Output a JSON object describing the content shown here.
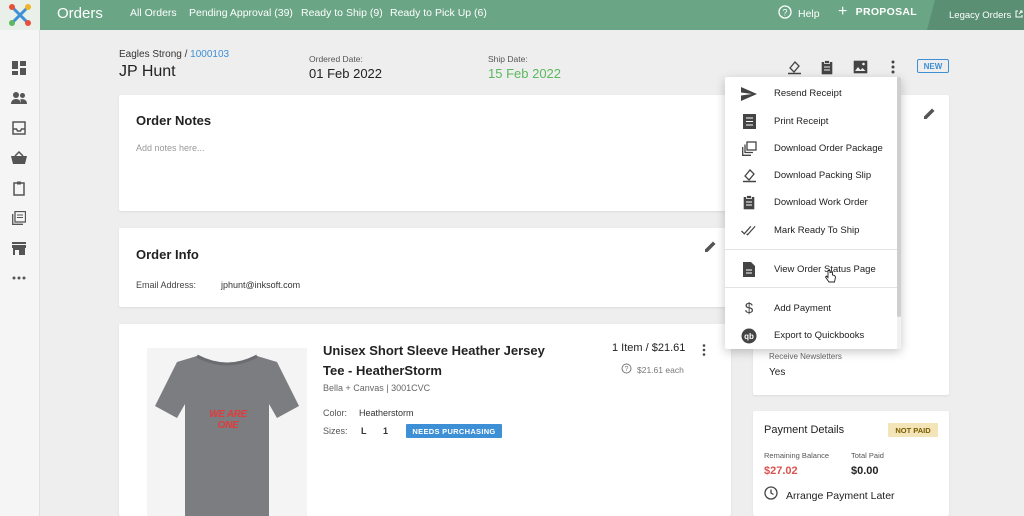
{
  "topbar": {
    "title": "Orders",
    "nav": [
      "All Orders",
      "Pending Approval (39)",
      "Ready to Ship (9)",
      "Ready to Pick Up (6)"
    ],
    "help": "Help",
    "proposal": "PROPOSAL",
    "legacy": "Legacy Orders"
  },
  "header": {
    "store": "Eagles Strong",
    "order_number": "1000103",
    "customer": "JP Hunt",
    "ordered_label": "Ordered Date:",
    "ordered_date": "01 Feb 2022",
    "ship_label": "Ship Date:",
    "ship_date": "15 Feb 2022",
    "badge": "NEW"
  },
  "notes": {
    "title": "Order Notes",
    "placeholder": "Add notes here..."
  },
  "info": {
    "title": "Order Info",
    "email_label": "Email Address:",
    "email": "jphunt@inksoft.com"
  },
  "product": {
    "name": "Unisex Short Sleeve Heather Jersey Tee - HeatherStorm",
    "brand": "Bella + Canvas | 3001CVC",
    "qty_price": "1 Item / $21.61",
    "each": "$21.61 each",
    "color_label": "Color:",
    "color": "Heatherstorm",
    "sizes_label": "Sizes:",
    "size": "L",
    "size_qty": "1",
    "status": "NEEDS PURCHASING",
    "shirt_text": "WE ARE ONE"
  },
  "customer_panel": {
    "newsletter_label": "Receive Newsletters",
    "newsletter_value": "Yes"
  },
  "payment": {
    "title": "Payment Details",
    "badge": "NOT PAID",
    "remaining_label": "Remaining Balance",
    "remaining": "$27.02",
    "paid_label": "Total Paid",
    "paid": "$0.00",
    "arrange": "Arrange Payment Later"
  },
  "menu": {
    "items": [
      {
        "label": "Resend Receipt",
        "icon": "send-icon"
      },
      {
        "label": "Print Receipt",
        "icon": "receipt-icon"
      },
      {
        "label": "Download Order Package",
        "icon": "package-icon"
      },
      {
        "label": "Download Packing Slip",
        "icon": "packing-slip-icon"
      },
      {
        "label": "Download Work Order",
        "icon": "clipboard-icon"
      },
      {
        "label": "Mark Ready To Ship",
        "icon": "double-check-icon"
      },
      {
        "label": "View Order Status Page",
        "icon": "document-icon"
      },
      {
        "label": "Add Payment",
        "icon": "dollar-icon"
      },
      {
        "label": "Export to Quickbooks",
        "icon": "quickbooks-icon"
      }
    ]
  },
  "colors": {
    "topbar": "#6aa585",
    "accent": "#3d8fd6",
    "ship_date": "#5bb85f",
    "balance": "#d9534f"
  }
}
